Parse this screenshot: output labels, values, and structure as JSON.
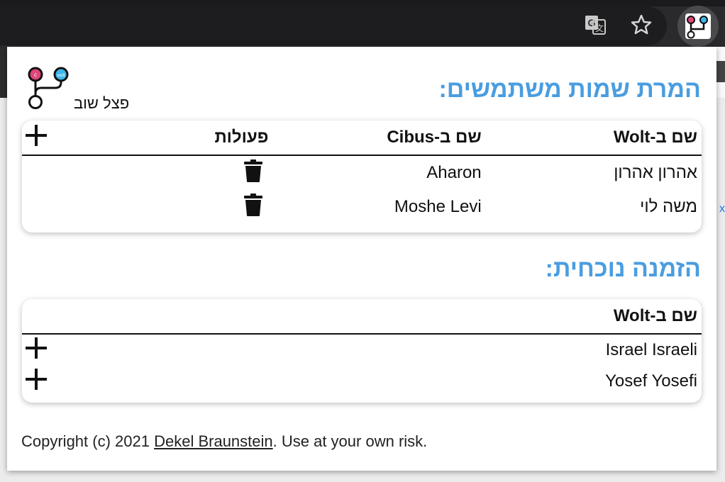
{
  "browser": {
    "translate_icon": "translate-icon",
    "bookmark_icon": "star-icon",
    "extension_icon": "branch-icon",
    "background_link_fragment": "x"
  },
  "popup": {
    "logo_text": "פצל שוב",
    "mappings_title": "המרת שמות משתמשים:",
    "mappings_table": {
      "headers": {
        "wolt": "שם ב-Wolt",
        "cibus": "שם ב-Cibus",
        "actions": "פעולות"
      },
      "add_icon": "plus-icon",
      "delete_icon": "trash-icon",
      "rows": [
        {
          "wolt": "אהרון אהרון",
          "cibus": "Aharon"
        },
        {
          "wolt": "משה לוי",
          "cibus": "Moshe Levi"
        }
      ]
    },
    "current_title": "הזמנה נוכחית:",
    "current_table": {
      "headers": {
        "wolt": "שם ב-Wolt"
      },
      "rows": [
        {
          "wolt": "Israel Israeli"
        },
        {
          "wolt": "Yosef Yosefi"
        }
      ]
    },
    "footer": {
      "prefix": "Copyright (c) 2021 ",
      "author": "Dekel Braunstein",
      "suffix": ". Use at your own risk."
    }
  },
  "colors": {
    "accent": "#4a9de0",
    "chrome_dark": "#2a2a2c"
  }
}
